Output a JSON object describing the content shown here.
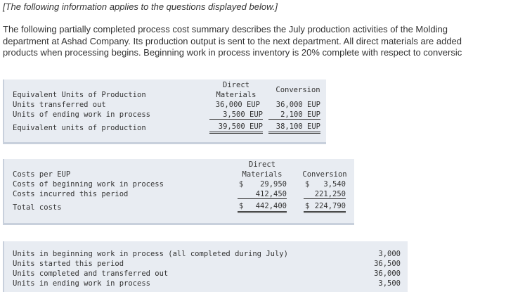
{
  "note": "[The following information applies to the questions displayed below.]",
  "intro_lines": [
    "The following partially completed process cost summary describes the July production activities of the Molding",
    "department at Ashad Company. Its production output is sent to the next department. All direct materials are added",
    "products when processing begins. Beginning work in process inventory is 20% complete with respect to conversic"
  ],
  "eup_table": {
    "title": "Equivalent Units of Production",
    "col_dm_line1": "Direct",
    "col_dm_line2": "Materials",
    "col_conv": "Conversion",
    "rows": [
      {
        "label": "Units transferred out",
        "dm": "36,000 EUP",
        "conv": "36,000 EUP"
      },
      {
        "label": "Units of ending work in process",
        "dm": "3,500 EUP",
        "conv": "2,100 EUP"
      }
    ],
    "total": {
      "label": "Equivalent units of production",
      "dm": "39,500 EUP",
      "conv": "38,100 EUP"
    }
  },
  "cost_table": {
    "title": "Costs per EUP",
    "col_dm_line1": "Direct",
    "col_dm_line2": "Materials",
    "col_conv": "Conversion",
    "rows": [
      {
        "label": "Costs of beginning work in process",
        "dm_sign": "$",
        "dm": "29,950",
        "conv_sign": "$",
        "conv": "3,540"
      },
      {
        "label": "Costs incurred this period",
        "dm_sign": "",
        "dm": "412,450",
        "conv_sign": "",
        "conv": "221,250"
      }
    ],
    "total": {
      "label": "Total costs",
      "dm_sign": "$",
      "dm": "442,400",
      "conv_sign": "$",
      "conv": "224,790"
    }
  },
  "units_table": {
    "rows": [
      {
        "label": "Units in beginning work in process (all completed during July)",
        "value": "3,000"
      },
      {
        "label": "Units started this period",
        "value": "36,500"
      },
      {
        "label": "Units completed and transferred out",
        "value": "36,000"
      },
      {
        "label": "Units in ending work in process",
        "value": "3,500"
      }
    ]
  }
}
